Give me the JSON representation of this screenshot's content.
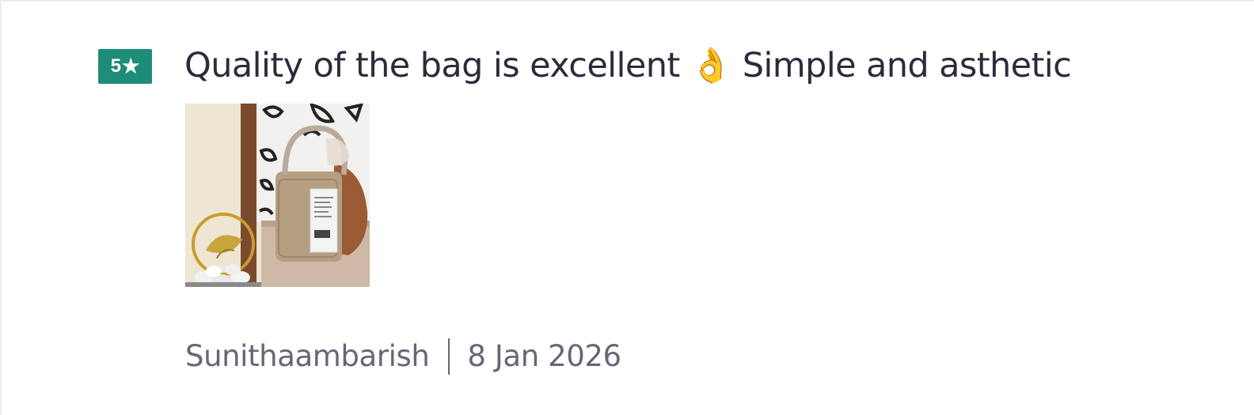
{
  "review": {
    "rating": "5",
    "star_icon": "★",
    "text": "Quality of the bag is excellent 👌  Simple and asthetic",
    "photo": {
      "subject": "bag photo",
      "colors": {
        "wall": "#ece3d3",
        "door_frame": "#7a4a2d",
        "bag_front": "#b49f82",
        "bag_side": "#9a5a33",
        "tag": "#f4f4f2"
      }
    },
    "author": "Sunithaambarish",
    "date": "8 Jan 2026"
  },
  "colors": {
    "badge": "#1e8c79",
    "text": "#2c2b3b",
    "meta": "#666677"
  }
}
